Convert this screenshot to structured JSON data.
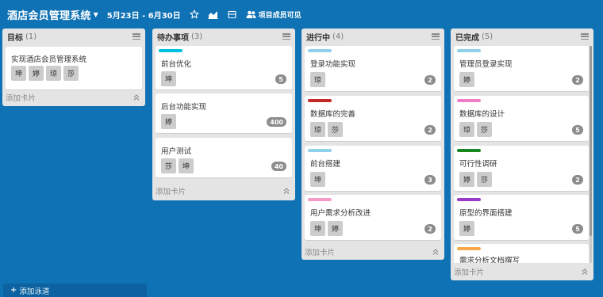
{
  "board": {
    "title": "酒店会员管理系统",
    "date_range": "5月23日 - 6月30日",
    "visibility": "项目成员可见"
  },
  "lists": [
    {
      "name": "目标",
      "count": "(1)",
      "add_card": "添加卡片",
      "cards": [
        {
          "title": "实现酒店会员管理系统",
          "label_color": null,
          "members": [
            "坤",
            "婷",
            "琼",
            "莎"
          ],
          "badge": null
        }
      ]
    },
    {
      "name": "待办事项",
      "count": "(3)",
      "add_card": "添加卡片",
      "cards": [
        {
          "title": "前台优化",
          "label_color": "#00c2e0",
          "members": [
            "坤"
          ],
          "badge": "5"
        },
        {
          "title": "后台功能实现",
          "label_color": null,
          "members": [
            "婷"
          ],
          "badge": "400"
        },
        {
          "title": "用户测试",
          "label_color": null,
          "members": [
            "莎",
            "坤"
          ],
          "badge": "40"
        }
      ]
    },
    {
      "name": "进行中",
      "count": "(4)",
      "add_card": "添加卡片",
      "cards": [
        {
          "title": "登录功能实现",
          "label_color": "#8fd0ea",
          "members": [
            "琼"
          ],
          "badge": "2"
        },
        {
          "title": "数据库的完善",
          "label_color": "#c62828",
          "members": [
            "琼",
            "莎"
          ],
          "badge": "2"
        },
        {
          "title": "前台搭建",
          "label_color": "#8fd0ea",
          "members": [
            "坤"
          ],
          "badge": "3"
        },
        {
          "title": "用户需求分析改进",
          "label_color": "#f59ac7",
          "members": [
            "坤",
            "婷"
          ],
          "badge": "2"
        }
      ]
    },
    {
      "name": "已完成",
      "count": "(5)",
      "add_card": "添加卡片",
      "cards": [
        {
          "title": "管理员登录实现",
          "label_color": "#8fd0ea",
          "members": [
            "婷"
          ],
          "badge": "2"
        },
        {
          "title": "数据库的设计",
          "label_color": "#f07cc5",
          "members": [
            "琼",
            "莎"
          ],
          "badge": "5"
        },
        {
          "title": "可行性调研",
          "label_color": "#17861f",
          "members": [
            "婷",
            "莎"
          ],
          "badge": "2"
        },
        {
          "title": "原型的界面搭建",
          "label_color": "#9c39c9",
          "members": [
            "婷"
          ],
          "badge": "5"
        },
        {
          "title": "需求分析文档撰写",
          "label_color": "#f5a94a",
          "members": [],
          "badge": null
        }
      ]
    }
  ],
  "add_lane": {
    "icon": "+",
    "label": "添加泳道"
  },
  "icons": [
    "chevron-down-icon",
    "star-icon",
    "chart-icon",
    "calendar-icon",
    "members-icon",
    "menu-icon",
    "collapse-icon",
    "plus-icon"
  ]
}
